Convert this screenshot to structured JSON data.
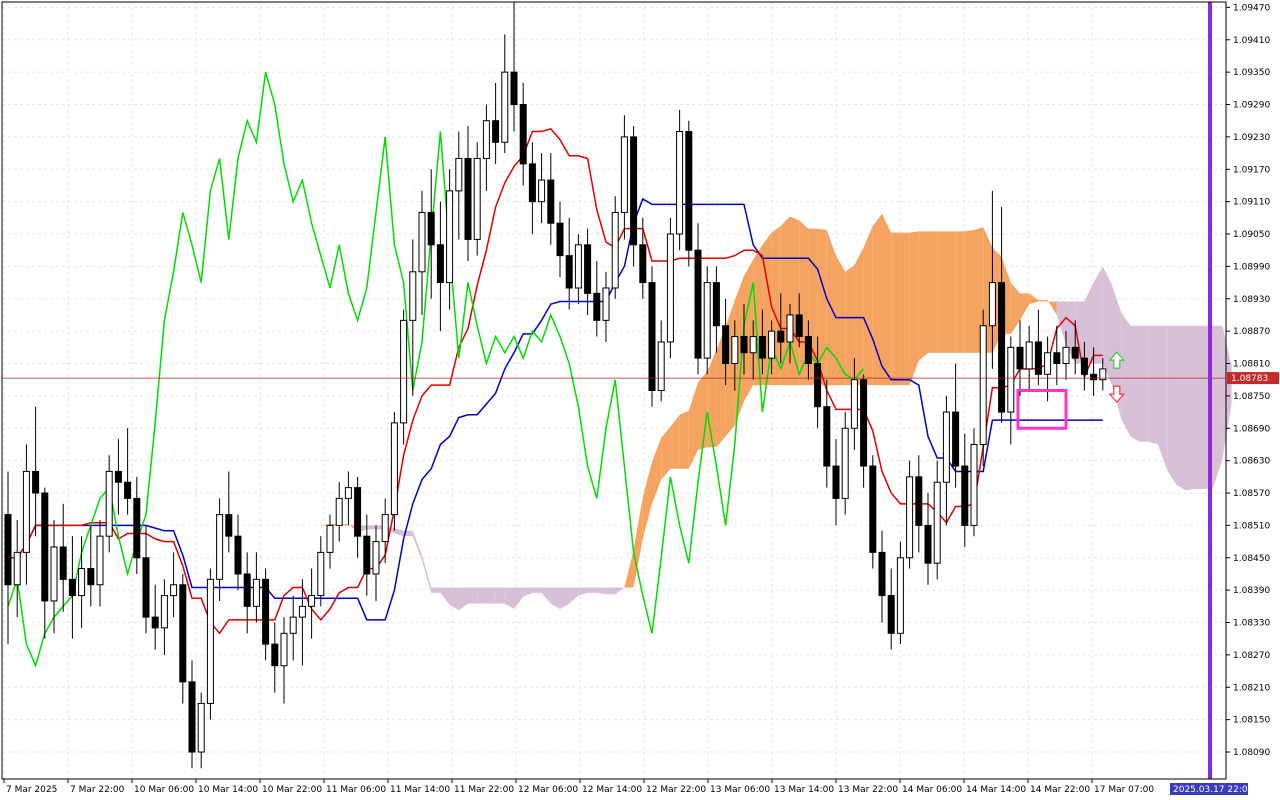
{
  "chart_data": {
    "type": "candlestick",
    "y_axis": {
      "ticks": [
        "1.09470",
        "1.09410",
        "1.09350",
        "1.09290",
        "1.09230",
        "1.09170",
        "1.09110",
        "1.09050",
        "1.08990",
        "1.08930",
        "1.08870",
        "1.08810",
        "1.08750",
        "1.08690",
        "1.08630",
        "1.08570",
        "1.08510",
        "1.08450",
        "1.08390",
        "1.08330",
        "1.08270",
        "1.08210",
        "1.08150",
        "1.08090"
      ],
      "range": [
        1.0804,
        1.0948
      ]
    },
    "x_axis": {
      "labels": [
        "7 Mar 2025",
        "7 Mar 22:00",
        "10 Mar 06:00",
        "10 Mar 14:00",
        "10 Mar 22:00",
        "11 Mar 06:00",
        "11 Mar 14:00",
        "11 Mar 22:00",
        "12 Mar 06:00",
        "12 Mar 14:00",
        "12 Mar 22:00",
        "13 Mar 06:00",
        "13 Mar 14:00",
        "13 Mar 22:00",
        "14 Mar 06:00",
        "14 Mar 14:00",
        "14 Mar 22:00",
        "17 Mar 07:00"
      ],
      "bar_count": 120
    },
    "current_price": "1.08783",
    "cursor_time_label": "2025.03.17 22:00",
    "grid": true,
    "candles": [
      [
        1.0853,
        1.0861,
        1.0829,
        1.084
      ],
      [
        1.084,
        1.0852,
        1.0834,
        1.0846
      ],
      [
        1.0846,
        1.0866,
        1.084,
        1.0861
      ],
      [
        1.0861,
        1.0873,
        1.0849,
        1.0857
      ],
      [
        1.0857,
        1.0858,
        1.083,
        1.0837
      ],
      [
        1.0837,
        1.0852,
        1.0831,
        1.0847
      ],
      [
        1.0847,
        1.0855,
        1.0835,
        1.0841
      ],
      [
        1.0841,
        1.0849,
        1.083,
        1.0838
      ],
      [
        1.0838,
        1.0849,
        1.0832,
        1.0843
      ],
      [
        1.0843,
        1.0851,
        1.0836,
        1.084
      ],
      [
        1.084,
        1.0852,
        1.0836,
        1.0849
      ],
      [
        1.0849,
        1.0864,
        1.0846,
        1.0861
      ],
      [
        1.0861,
        1.0867,
        1.0853,
        1.0859
      ],
      [
        1.0859,
        1.0869,
        1.0853,
        1.0856
      ],
      [
        1.0856,
        1.086,
        1.0842,
        1.0845
      ],
      [
        1.0845,
        1.0851,
        1.0831,
        1.0834
      ],
      [
        1.0834,
        1.084,
        1.0828,
        1.0832
      ],
      [
        1.0832,
        1.0841,
        1.0827,
        1.0838
      ],
      [
        1.0838,
        1.0846,
        1.0834,
        1.084
      ],
      [
        1.084,
        1.0842,
        1.0818,
        1.0822
      ],
      [
        1.0822,
        1.0826,
        1.0806,
        1.0809
      ],
      [
        1.0809,
        1.082,
        1.0806,
        1.0818
      ],
      [
        1.0818,
        1.0843,
        1.0815,
        1.0841
      ],
      [
        1.0841,
        1.0856,
        1.0837,
        1.0853
      ],
      [
        1.0853,
        1.0861,
        1.0846,
        1.0849
      ],
      [
        1.0849,
        1.0853,
        1.0839,
        1.0842
      ],
      [
        1.0842,
        1.0846,
        1.0831,
        1.0836
      ],
      [
        1.0836,
        1.0846,
        1.0833,
        1.0841
      ],
      [
        1.0841,
        1.0843,
        1.0826,
        1.0829
      ],
      [
        1.0829,
        1.0833,
        1.082,
        1.0825
      ],
      [
        1.0825,
        1.0834,
        1.0818,
        1.0831
      ],
      [
        1.0831,
        1.0838,
        1.0826,
        1.0834
      ],
      [
        1.0834,
        1.0841,
        1.0825,
        1.0836
      ],
      [
        1.0836,
        1.0843,
        1.083,
        1.0838
      ],
      [
        1.0838,
        1.0849,
        1.0836,
        1.0846
      ],
      [
        1.0846,
        1.0853,
        1.0843,
        1.0851
      ],
      [
        1.0851,
        1.0859,
        1.0848,
        1.0856
      ],
      [
        1.0856,
        1.0861,
        1.0851,
        1.0858
      ],
      [
        1.0858,
        1.086,
        1.0845,
        1.0849
      ],
      [
        1.0849,
        1.0853,
        1.0838,
        1.0842
      ],
      [
        1.0842,
        1.0851,
        1.0837,
        1.0848
      ],
      [
        1.0848,
        1.0856,
        1.0844,
        1.0853
      ],
      [
        1.0853,
        1.0872,
        1.085,
        1.087
      ],
      [
        1.087,
        1.0891,
        1.0866,
        1.0889
      ],
      [
        1.0889,
        1.0904,
        1.0875,
        1.0898
      ],
      [
        1.0898,
        1.0913,
        1.089,
        1.0909
      ],
      [
        1.0909,
        1.0917,
        1.0893,
        1.0903
      ],
      [
        1.0903,
        1.0911,
        1.0887,
        1.0896
      ],
      [
        1.0896,
        1.0917,
        1.0891,
        1.0913
      ],
      [
        1.0913,
        1.0924,
        1.0904,
        1.0919
      ],
      [
        1.0919,
        1.0925,
        1.09,
        1.0904
      ],
      [
        1.0904,
        1.0922,
        1.0901,
        1.0919
      ],
      [
        1.0919,
        1.0929,
        1.0913,
        1.0926
      ],
      [
        1.0926,
        1.0933,
        1.0918,
        1.0922
      ],
      [
        1.0922,
        1.0942,
        1.092,
        1.0935
      ],
      [
        1.0935,
        1.0948,
        1.0924,
        1.0929
      ],
      [
        1.0929,
        1.0933,
        1.0914,
        1.0918
      ],
      [
        1.0918,
        1.0922,
        1.0905,
        1.0911
      ],
      [
        1.0911,
        1.092,
        1.0907,
        1.0915
      ],
      [
        1.0915,
        1.092,
        1.0903,
        1.0907
      ],
      [
        1.0907,
        1.0911,
        1.0897,
        1.0901
      ],
      [
        1.0901,
        1.0908,
        1.0891,
        1.0895
      ],
      [
        1.0895,
        1.0905,
        1.0892,
        1.0903
      ],
      [
        1.0903,
        1.0906,
        1.089,
        1.0894
      ],
      [
        1.0894,
        1.09,
        1.0886,
        1.0889
      ],
      [
        1.0889,
        1.0898,
        1.0885,
        1.0895
      ],
      [
        1.0895,
        1.0912,
        1.0893,
        1.0909
      ],
      [
        1.0909,
        1.0927,
        1.0904,
        1.0923
      ],
      [
        1.0923,
        1.0925,
        1.0899,
        1.0903
      ],
      [
        1.0903,
        1.0908,
        1.0893,
        1.0896
      ],
      [
        1.0896,
        1.0899,
        1.0873,
        1.0876
      ],
      [
        1.0876,
        1.0889,
        1.0874,
        1.0885
      ],
      [
        1.0885,
        1.0908,
        1.0882,
        1.0905
      ],
      [
        1.0905,
        1.0928,
        1.0902,
        1.0924
      ],
      [
        1.0924,
        1.0926,
        1.0899,
        1.0902
      ],
      [
        1.0902,
        1.0907,
        1.0879,
        1.0882
      ],
      [
        1.0882,
        1.0899,
        1.0879,
        1.0896
      ],
      [
        1.0896,
        1.0899,
        1.0883,
        1.0888
      ],
      [
        1.0888,
        1.0893,
        1.0877,
        1.0881
      ],
      [
        1.0881,
        1.0889,
        1.0876,
        1.0886
      ],
      [
        1.0886,
        1.0892,
        1.0879,
        1.0883
      ],
      [
        1.0883,
        1.0889,
        1.0878,
        1.0886
      ],
      [
        1.0886,
        1.0891,
        1.0879,
        1.0882
      ],
      [
        1.0882,
        1.0889,
        1.0879,
        1.0887
      ],
      [
        1.0887,
        1.0894,
        1.0881,
        1.0885
      ],
      [
        1.0885,
        1.0892,
        1.0881,
        1.089
      ],
      [
        1.089,
        1.0894,
        1.0884,
        1.0886
      ],
      [
        1.0886,
        1.0889,
        1.0878,
        1.0881
      ],
      [
        1.0881,
        1.0886,
        1.0869,
        1.0873
      ],
      [
        1.0873,
        1.0878,
        1.0858,
        1.0862
      ],
      [
        1.0862,
        1.0867,
        1.0851,
        1.0856
      ],
      [
        1.0856,
        1.0872,
        1.0853,
        1.0869
      ],
      [
        1.0869,
        1.0882,
        1.0865,
        1.0878
      ],
      [
        1.0878,
        1.0879,
        1.0858,
        1.0862
      ],
      [
        1.0862,
        1.0864,
        1.0843,
        1.0846
      ],
      [
        1.0846,
        1.085,
        1.0833,
        1.0838
      ],
      [
        1.0838,
        1.0843,
        1.0828,
        1.0831
      ],
      [
        1.0831,
        1.0848,
        1.0829,
        1.0845
      ],
      [
        1.0845,
        1.0863,
        1.0843,
        1.086
      ],
      [
        1.086,
        1.0864,
        1.0846,
        1.0851
      ],
      [
        1.0851,
        1.0857,
        1.084,
        1.0844
      ],
      [
        1.0844,
        1.0863,
        1.0841,
        1.0859
      ],
      [
        1.0859,
        1.0875,
        1.0851,
        1.0872
      ],
      [
        1.0872,
        1.0881,
        1.0858,
        1.0862
      ],
      [
        1.0862,
        1.0868,
        1.0847,
        1.0851
      ],
      [
        1.0851,
        1.0869,
        1.0849,
        1.0866
      ],
      [
        1.0866,
        1.0891,
        1.0862,
        1.0888
      ],
      [
        1.0888,
        1.0913,
        1.088,
        1.0896
      ],
      [
        1.0896,
        1.091,
        1.087,
        1.0872
      ],
      [
        1.0872,
        1.0886,
        1.0866,
        1.0884
      ],
      [
        1.0884,
        1.0889,
        1.0875,
        1.088
      ],
      [
        1.088,
        1.0888,
        1.0876,
        1.0885
      ],
      [
        1.0885,
        1.0891,
        1.0877,
        1.0879
      ],
      [
        1.0879,
        1.0886,
        1.0874,
        1.0883
      ],
      [
        1.0883,
        1.0888,
        1.0877,
        1.0881
      ],
      [
        1.0881,
        1.0887,
        1.0878,
        1.0884
      ],
      [
        1.0884,
        1.0889,
        1.0879,
        1.0882
      ],
      [
        1.0882,
        1.0885,
        1.0876,
        1.0879
      ],
      [
        1.0879,
        1.0884,
        1.0875,
        1.0878
      ],
      [
        1.0878,
        1.0882,
        1.0876,
        1.088
      ]
    ],
    "indicators": {
      "tenkan_sen_color": "#e00000",
      "kijun_sen_color": "#0000cc",
      "chikou_span_color": "#00dd00",
      "kumo_bullish_color": "#f4a460",
      "kumo_bearish_color": "#d8bfd8",
      "bull_candle_color": "#ffffff",
      "bear_candle_color": "#000000",
      "signal_up_color": "#33cc33",
      "signal_down_color": "#ff3333",
      "highlight_box_color": "#ff33cc",
      "period_separator_color": "#8a2be2"
    }
  }
}
